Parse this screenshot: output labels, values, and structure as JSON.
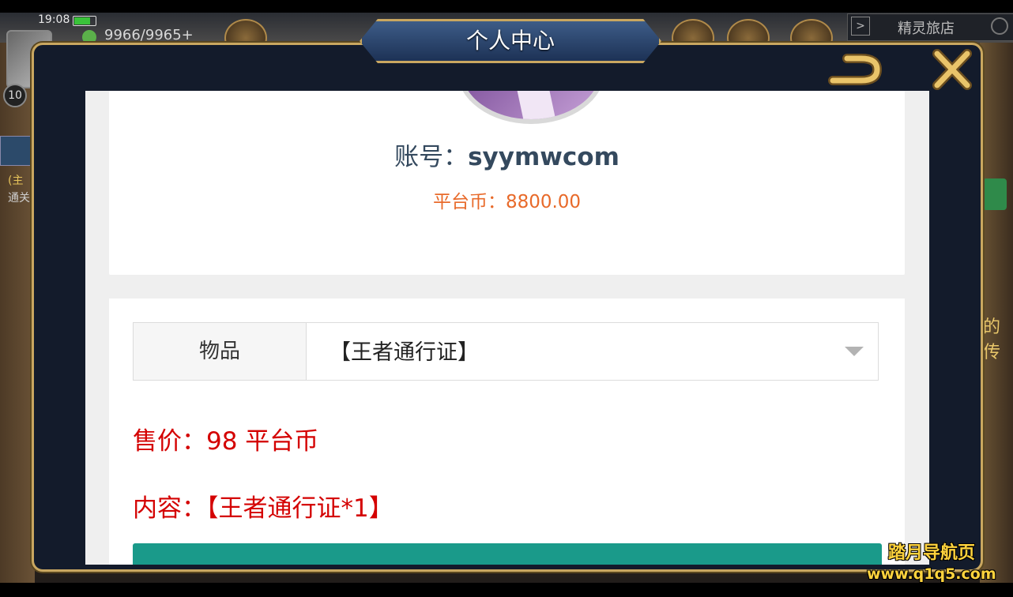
{
  "status_bar": {
    "time": "19:08"
  },
  "game_hud": {
    "energy": "9966/9965+",
    "level": "10",
    "side_text_1": "(主",
    "side_text_2": "通关",
    "shop_name": "精灵旅店",
    "right_text": "的传"
  },
  "panel": {
    "title": "个人中心",
    "back_icon": "back-arrow-icon",
    "close_icon": "close-x-icon"
  },
  "profile": {
    "account_label": "账号：",
    "account_value": "syymwcom",
    "balance_label": "平台币：",
    "balance_value": "8800.00"
  },
  "purchase": {
    "item_label": "物品",
    "item_value": "【王者通行证】",
    "price_label": "售价：",
    "price_value": "98 平台币",
    "content_label": "内容：",
    "content_value": "【王者通行证*1】"
  },
  "watermark": {
    "name": "踏月导航页",
    "url": "www.q1q5.com"
  },
  "colors": {
    "panel_bg": "#131b2b",
    "panel_border": "#c9a760",
    "balance": "#e86a2a",
    "price": "#d40000",
    "button": "#1a9a8a",
    "account_text": "#34495e"
  }
}
